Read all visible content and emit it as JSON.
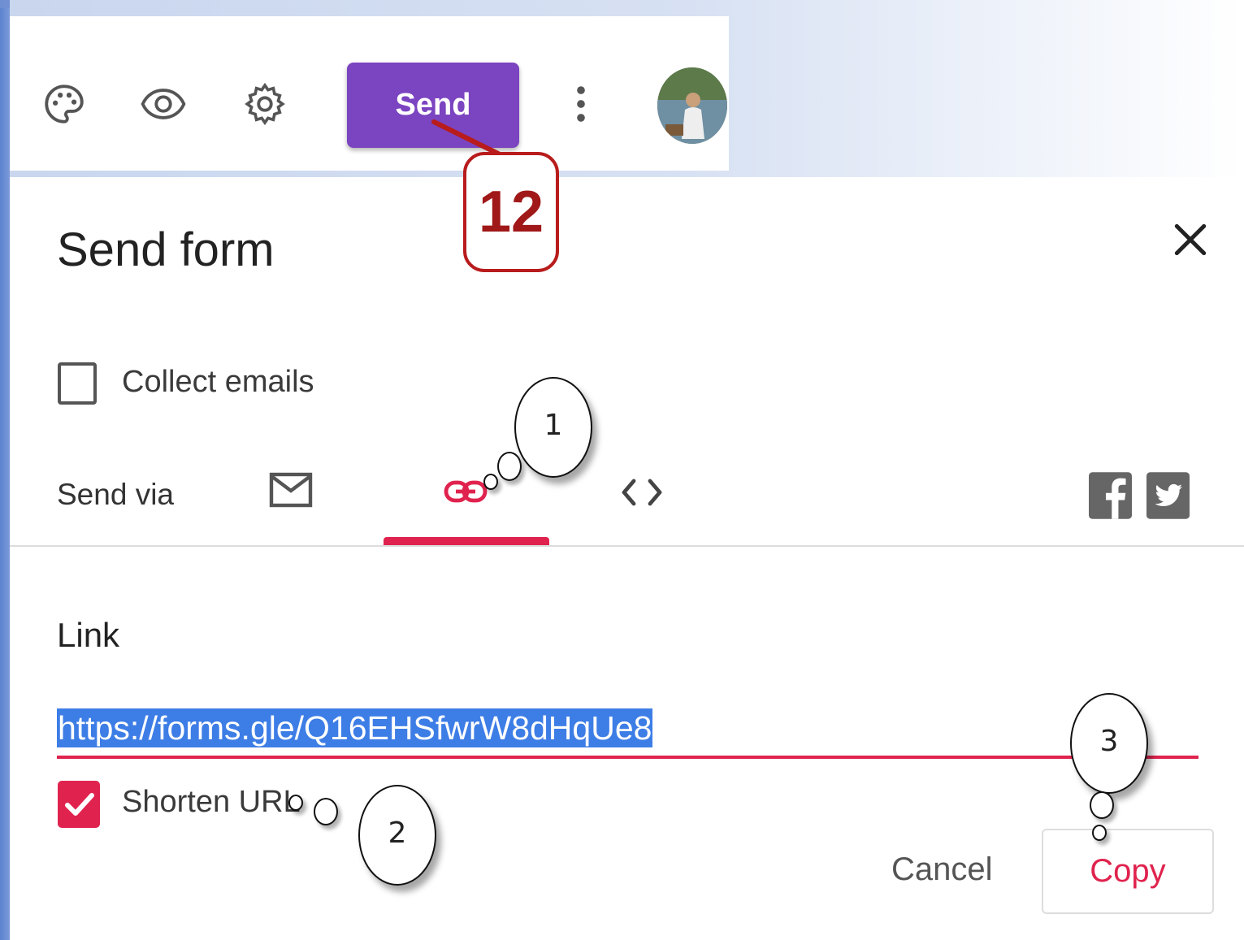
{
  "toolbar": {
    "send_label": "Send",
    "icons": [
      "palette-icon",
      "preview-eye-icon",
      "settings-gear-icon",
      "more-vert-icon"
    ]
  },
  "callout_step": "12",
  "dialog": {
    "title": "Send form",
    "collect_emails_label": "Collect emails",
    "collect_emails_checked": false,
    "send_via_label": "Send via",
    "tabs": [
      "email-icon",
      "link-icon",
      "embed-code-icon"
    ],
    "active_tab": "link-icon",
    "social": [
      "facebook-icon",
      "twitter-icon"
    ],
    "link_label": "Link",
    "link_url": "https://forms.gle/Q16EHSfwrW8dHqUe8",
    "shorten_url_label": "Shorten URL",
    "shorten_url_checked": true,
    "cancel_label": "Cancel",
    "copy_label": "Copy"
  },
  "annotations": [
    "1",
    "2",
    "3"
  ],
  "colors": {
    "accent": "#e0234e",
    "send_button": "#7b44c0",
    "callout": "#b81c1c",
    "selection": "#3d7de6"
  }
}
